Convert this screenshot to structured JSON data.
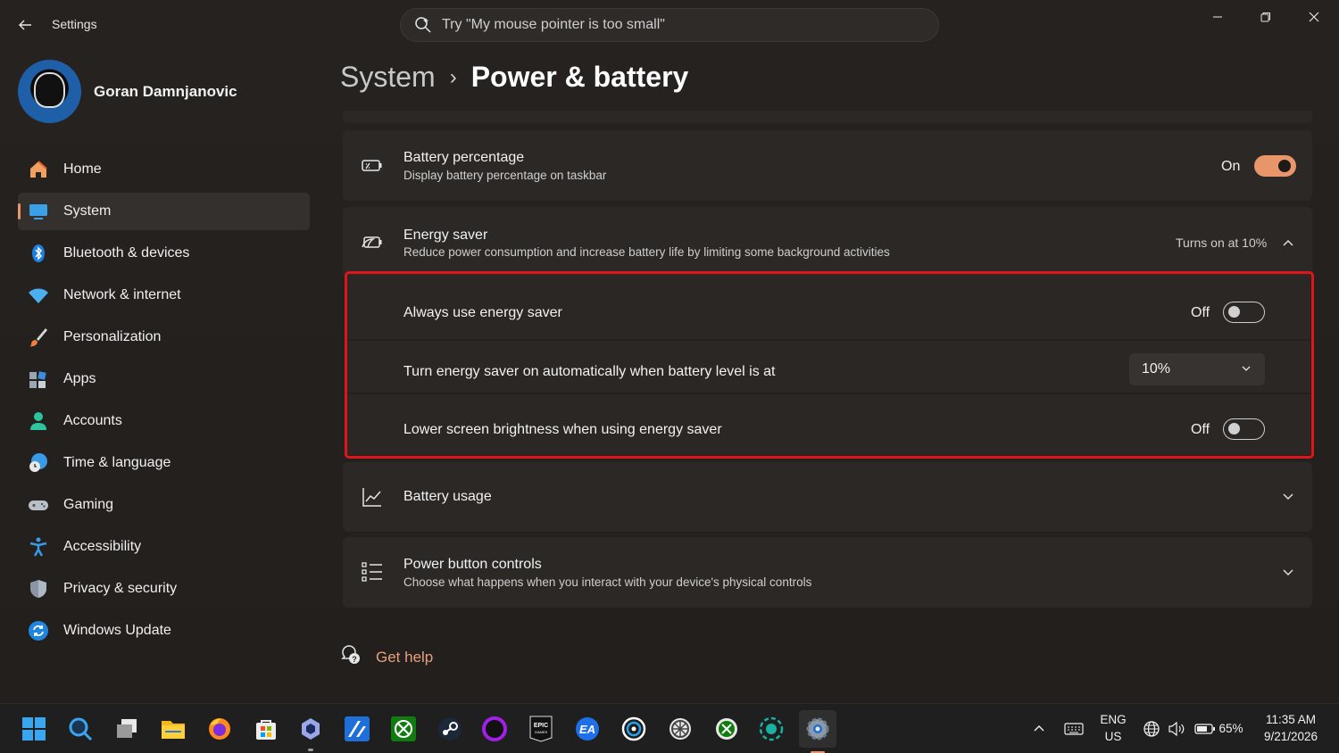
{
  "titlebar": {
    "back_icon": "back-arrow-icon",
    "app_title": "Settings",
    "search_placeholder": "Try \"My mouse pointer is too small\"",
    "minimize_icon": "minimize-icon",
    "restore_icon": "restore-icon",
    "close_icon": "close-icon"
  },
  "profile": {
    "name": "Goran Damnjanovic"
  },
  "sidebar": {
    "items": [
      {
        "label": "Home",
        "icon": "home-icon",
        "active": false
      },
      {
        "label": "System",
        "icon": "system-display-icon",
        "active": true
      },
      {
        "label": "Bluetooth & devices",
        "icon": "bluetooth-icon",
        "active": false
      },
      {
        "label": "Network & internet",
        "icon": "wifi-icon",
        "active": false
      },
      {
        "label": "Personalization",
        "icon": "brush-icon",
        "active": false
      },
      {
        "label": "Apps",
        "icon": "apps-icon",
        "active": false
      },
      {
        "label": "Accounts",
        "icon": "person-icon",
        "active": false
      },
      {
        "label": "Time & language",
        "icon": "globe-clock-icon",
        "active": false
      },
      {
        "label": "Gaming",
        "icon": "gamepad-icon",
        "active": false
      },
      {
        "label": "Accessibility",
        "icon": "accessibility-icon",
        "active": false
      },
      {
        "label": "Privacy & security",
        "icon": "shield-icon",
        "active": false
      },
      {
        "label": "Windows Update",
        "icon": "update-icon",
        "active": false
      }
    ]
  },
  "breadcrumb": {
    "parent": "System",
    "separator": "›",
    "current": "Power & battery"
  },
  "battery_percentage": {
    "title": "Battery percentage",
    "subtitle": "Display battery percentage on taskbar",
    "state": "On",
    "on": true
  },
  "energy_saver": {
    "title": "Energy saver",
    "subtitle": "Reduce power consumption and increase battery life by limiting some background activities",
    "status": "Turns on at 10%",
    "always": {
      "label": "Always use energy saver",
      "state": "Off",
      "on": false
    },
    "auto": {
      "label": "Turn energy saver on automatically when battery level is at",
      "value": "10%"
    },
    "brightness": {
      "label": "Lower screen brightness when using energy saver",
      "state": "Off",
      "on": false
    }
  },
  "battery_usage": {
    "title": "Battery usage"
  },
  "power_button": {
    "title": "Power button controls",
    "subtitle": "Choose what happens when you interact with your device's physical controls"
  },
  "help": {
    "label": "Get help"
  },
  "taskbar": {
    "apps": [
      "start-icon",
      "search-icon",
      "task-view-icon",
      "file-explorer-icon",
      "firefox-icon",
      "microsoft-store-icon",
      "app-icon",
      "affinity-icon",
      "xbox-icon",
      "steam-icon",
      "circle-app-icon",
      "epic-games-icon",
      "ea-icon",
      "ubisoft-icon",
      "wheel-app-icon",
      "xbox-accessory-icon",
      "app-ring-icon",
      "settings-icon"
    ],
    "language_line1": "ENG",
    "language_line2": "US",
    "battery": "65%",
    "time": "11:35 AM",
    "date": "9/21/2026"
  },
  "colors": {
    "accent": "#e8956a",
    "highlight_box": "#e0141b",
    "background": "#221f1d",
    "card": "#2b2826"
  }
}
